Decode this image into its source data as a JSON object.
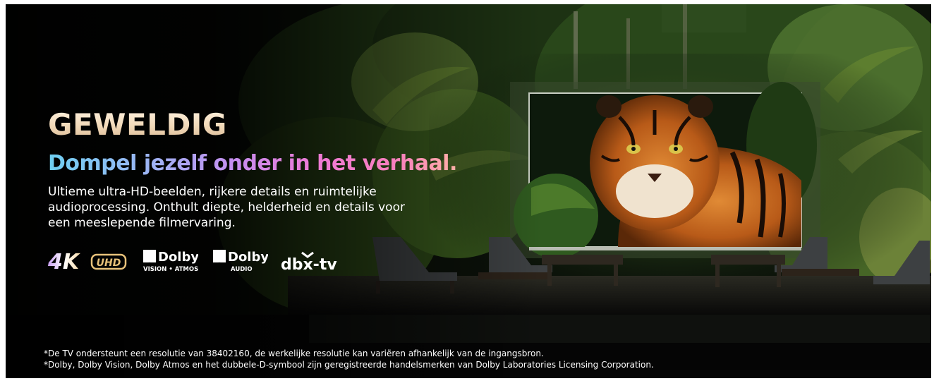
{
  "hero": {
    "headline": "GEWELDIG",
    "tagline": "Dompel jezelf onder in het verhaal.",
    "description": "Ultieme ultra-HD-beelden, rijkere details en ruimtelijke audioprocessing. Onthult diepte, helderheid en details voor een meeslepende filmervaring."
  },
  "logos": {
    "uhd_4k": {
      "big": "4K",
      "box": "UHD"
    },
    "dolby_vision_atmos": {
      "brand": "Dolby",
      "sub": "VISION • ATMOS"
    },
    "dolby_audio": {
      "brand": "Dolby",
      "sub": "AUDIO"
    },
    "dbx_tv": {
      "text": "dbx-tv"
    }
  },
  "disclaimer": {
    "line1": "*De TV ondersteunt een resolutie van 38402160, de werkelijke resolutie kan variëren afhankelijk van de ingangsbron.",
    "line2": "*Dolby, Dolby Vision, Dolby Atmos en het dubbele-D-symbool zijn geregistreerde handelsmerken van Dolby Laboratories Licensing Corporation."
  },
  "colors": {
    "background": "#050807",
    "foliage": "#2f5a1f",
    "tiger_orange": "#c8681e",
    "tagline_gradient": [
      "#6fd0f2",
      "#c58ff0",
      "#f97fbd",
      "#ffb0a6"
    ]
  },
  "icons": [
    "tiger-image",
    "tv-screen",
    "lounge-chair",
    "outdoor-table",
    "palm-foliage",
    "4k-uhd-logo",
    "dolby-vision-atmos-logo",
    "dolby-audio-logo",
    "dbx-tv-logo"
  ]
}
